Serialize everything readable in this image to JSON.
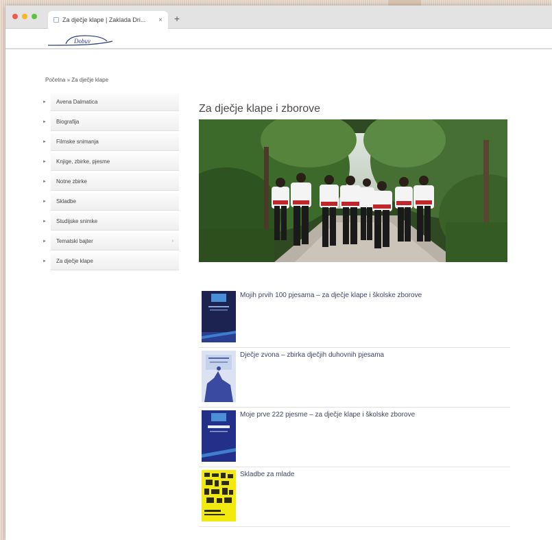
{
  "browser": {
    "tab_title": "Za dječje klape | Zaklada Dri...",
    "tab_close": "×",
    "new_tab": "+"
  },
  "logo": {
    "text": "Dobuv"
  },
  "breadcrumb": "Početna » Za dječje klape",
  "sidebar": {
    "items": [
      {
        "label": "Avena Dalmatica",
        "has_submenu": false
      },
      {
        "label": "Biografija",
        "has_submenu": false
      },
      {
        "label": "Filmske snimanja",
        "has_submenu": false
      },
      {
        "label": "Knjige, zbirke, pjesme",
        "has_submenu": false
      },
      {
        "label": "Notne zbirke",
        "has_submenu": false
      },
      {
        "label": "Skladbe",
        "has_submenu": false
      },
      {
        "label": "Studijske snimke",
        "has_submenu": false
      },
      {
        "label": "Tematski bajter",
        "has_submenu": true
      },
      {
        "label": "Za dječje klape",
        "has_submenu": false
      }
    ],
    "bullet": "►",
    "chevron": "›"
  },
  "main": {
    "title": "Za dječje klape i zborove"
  },
  "books": [
    {
      "title": "Mojih prvih 100 pjesama – za dječje klape i školske zborove",
      "cover_style": "dark-blue"
    },
    {
      "title": "Dječje zvona – zbirka dječjih duhovnih pjesama",
      "cover_style": "light-blue"
    },
    {
      "title": "Moje prve 222 pjesme – za dječje klape i školske zborove",
      "cover_style": "blue"
    },
    {
      "title": "Skladbe za mlade",
      "cover_style": "yellow"
    }
  ],
  "colors": {
    "window_bg": "#ffffff",
    "page_bg": "#e9d9cc",
    "title": "#4a4a4a",
    "link": "#3b4566"
  }
}
